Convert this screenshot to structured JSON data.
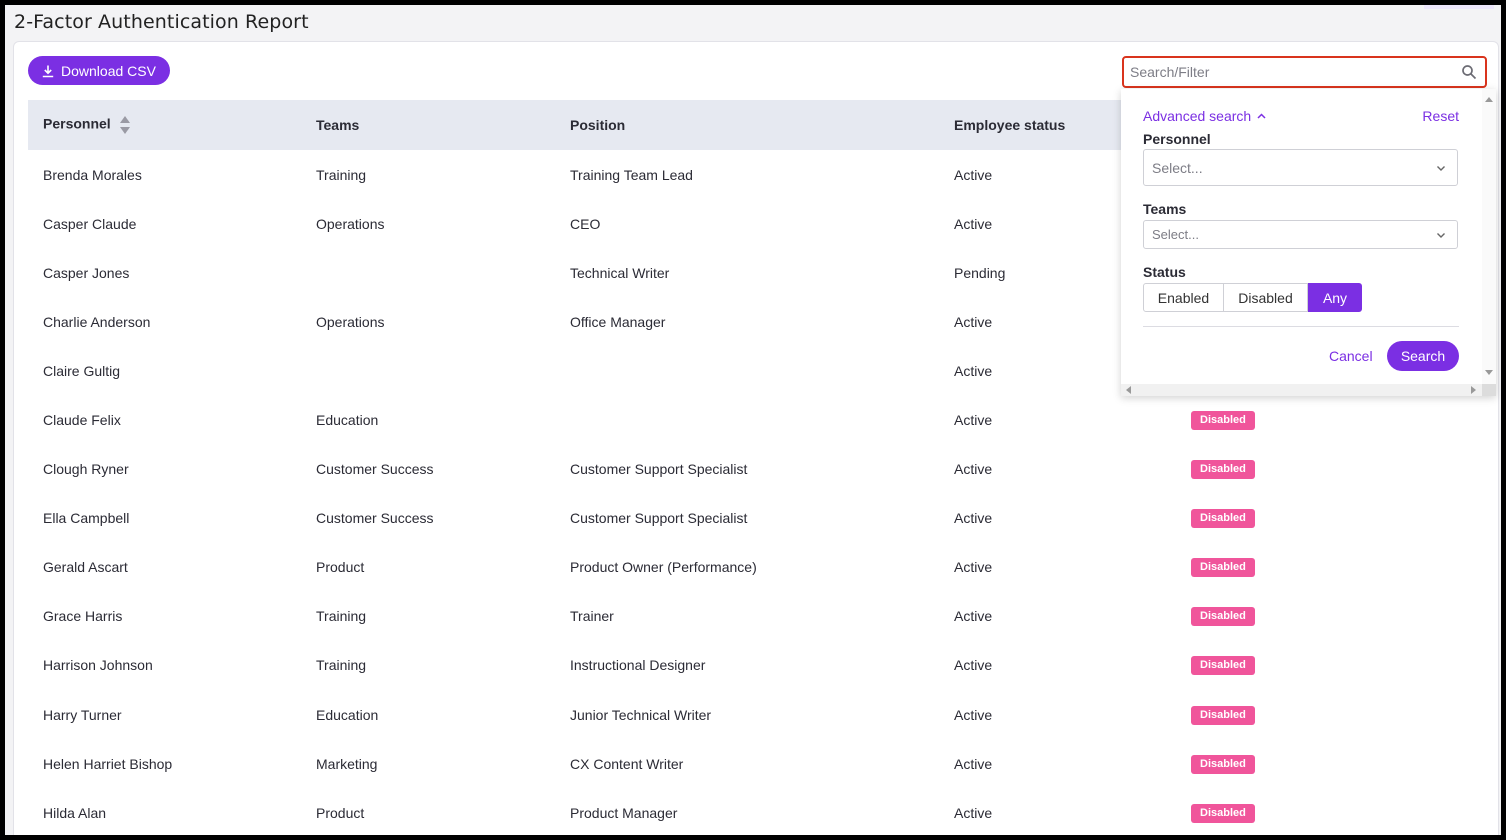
{
  "page": {
    "title": "2-Factor Authentication Report"
  },
  "toolbar": {
    "download_label": "Download CSV"
  },
  "search": {
    "placeholder": "Search/Filter"
  },
  "table": {
    "headers": {
      "personnel": "Personnel",
      "teams": "Teams",
      "position": "Position",
      "employee_status": "Employee status"
    },
    "rows": [
      {
        "name": "Brenda Morales",
        "team": "Training",
        "position": "Training Team Lead",
        "status": "Active",
        "twofa": ""
      },
      {
        "name": "Casper Claude",
        "team": "Operations",
        "position": "CEO",
        "status": "Active",
        "twofa": ""
      },
      {
        "name": "Casper Jones",
        "team": "",
        "position": "Technical Writer",
        "status": "Pending",
        "twofa": ""
      },
      {
        "name": "Charlie Anderson",
        "team": "Operations",
        "position": "Office Manager",
        "status": "Active",
        "twofa": ""
      },
      {
        "name": "Claire Gultig",
        "team": "",
        "position": "",
        "status": "Active",
        "twofa": ""
      },
      {
        "name": "Claude Felix",
        "team": "Education",
        "position": "",
        "status": "Active",
        "twofa": "Disabled"
      },
      {
        "name": "Clough Ryner",
        "team": "Customer Success",
        "position": "Customer Support Specialist",
        "status": "Active",
        "twofa": "Disabled"
      },
      {
        "name": "Ella Campbell",
        "team": "Customer Success",
        "position": "Customer Support Specialist",
        "status": "Active",
        "twofa": "Disabled"
      },
      {
        "name": "Gerald Ascart",
        "team": "Product",
        "position": "Product Owner (Performance)",
        "status": "Active",
        "twofa": "Disabled"
      },
      {
        "name": "Grace Harris",
        "team": "Training",
        "position": "Trainer",
        "status": "Active",
        "twofa": "Disabled"
      },
      {
        "name": "Harrison Johnson",
        "team": "Training",
        "position": "Instructional Designer",
        "status": "Active",
        "twofa": "Disabled"
      },
      {
        "name": "Harry Turner",
        "team": "Education",
        "position": "Junior Technical Writer",
        "status": "Active",
        "twofa": "Disabled"
      },
      {
        "name": "Helen Harriet Bishop",
        "team": "Marketing",
        "position": "CX Content Writer",
        "status": "Active",
        "twofa": "Disabled"
      },
      {
        "name": "Hilda Alan",
        "team": "Product",
        "position": "Product Manager",
        "status": "Active",
        "twofa": "Disabled"
      }
    ]
  },
  "advanced": {
    "toggle_label": "Advanced search",
    "reset_label": "Reset",
    "personnel_label": "Personnel",
    "personnel_placeholder": "Select...",
    "teams_label": "Teams",
    "teams_placeholder": "Select...",
    "status_label": "Status",
    "status_options": [
      "Enabled",
      "Disabled",
      "Any"
    ],
    "status_selected": "Any",
    "cancel_label": "Cancel",
    "search_label": "Search"
  },
  "colors": {
    "accent": "#7b2fe3",
    "badge_disabled": "#f0559b",
    "header_bg": "#e6e9f1",
    "focus_border": "#d9341d"
  }
}
